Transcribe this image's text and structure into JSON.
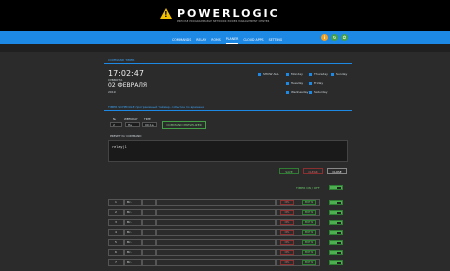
{
  "header": {
    "brand": "POWERLOGIC",
    "tagline": "PRECISE PROGRAMMABLE NETWORK POWER MANAGEMENT CENTER"
  },
  "nav": {
    "items": [
      {
        "label": "COMMANDS",
        "active": false
      },
      {
        "label": "RELAY",
        "active": false
      },
      {
        "label": "ROMS",
        "active": false
      },
      {
        "label": "PLANER",
        "active": true
      },
      {
        "label": "CLOUD APPS",
        "active": false
      },
      {
        "label": "SETTING",
        "active": false
      }
    ],
    "circles": [
      {
        "icon": "info-icon",
        "glyph": "i",
        "color": "#f0a020"
      },
      {
        "icon": "refresh-icon",
        "glyph": "↻",
        "color": "#43a047"
      },
      {
        "icon": "power-icon",
        "glyph": "⏻",
        "color": "#43a047"
      }
    ]
  },
  "section_title": "COMMAND TIMER",
  "clock": {
    "time": "17:02:47",
    "weekday": "СУББОТА",
    "date": "02 ФЕВРАЛЯ",
    "year": "2019"
  },
  "days": {
    "show_all": "SHOW ALL",
    "monday": "Monday",
    "tuesday": "Tuesday",
    "wednesday": "Wednesday",
    "thursday": "Thursday",
    "friday": "Friday",
    "saturday": "Saturday",
    "sunday": "Sunday"
  },
  "schedule": {
    "title": "TIMER SCHEDULE",
    "subtitle": "программный таймер, событие по времени",
    "col_labels": {
      "n": "№",
      "weekday": "WEEKDAY",
      "time": "TIME"
    },
    "n_value": "2",
    "weekday_value": "Пн",
    "time_value": "00:1a",
    "command_button": "COMMAND PRESELIZER",
    "textarea_label": "PRESET for COMMAND",
    "textarea_value": "relay|1",
    "buttons": {
      "save": "SAVE",
      "clear": "CLEAR",
      "close": "CLOSE"
    }
  },
  "timer_toggle_label": "TIMER ON / OFF",
  "rows": [
    {
      "n": "1",
      "label": "Вс.",
      "del": "DEL",
      "edit": "EDIT N"
    },
    {
      "n": "2",
      "label": "Вс.",
      "del": "DEL",
      "edit": "EDIT N"
    },
    {
      "n": "3",
      "label": "Вс.",
      "del": "DEL",
      "edit": "EDIT N"
    },
    {
      "n": "4",
      "label": "Вс.",
      "del": "DEL",
      "edit": "EDIT N"
    },
    {
      "n": "5",
      "label": "Вс.",
      "del": "DEL",
      "edit": "EDIT N"
    },
    {
      "n": "6",
      "label": "Вс.",
      "del": "DEL",
      "edit": "EDIT N"
    },
    {
      "n": "7",
      "label": "Вс.",
      "del": "DEL",
      "edit": "EDIT N"
    }
  ],
  "colors": {
    "accent": "#1e88e5",
    "toggle_on": "#4caf50",
    "delete": "#d46a6a",
    "edit": "#6cc96c",
    "warning": "#f2c200"
  }
}
